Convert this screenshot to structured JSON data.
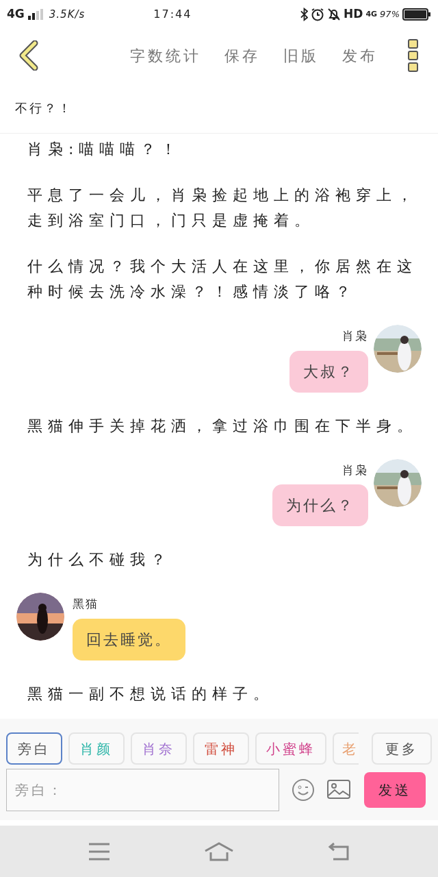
{
  "status_bar": {
    "network": "4G",
    "speed": "3.5K/s",
    "time": "17:44",
    "hd": "HD",
    "network_right": "4G",
    "battery": "97%"
  },
  "toolbar": {
    "actions": [
      "字数统计",
      "保存",
      "旧版",
      "发布"
    ]
  },
  "pinned_text": "不行？！",
  "feed": [
    {
      "kind": "text",
      "text": "肖枭:喵喵喵？！"
    },
    {
      "kind": "text",
      "text": "平息了一会儿，肖枭捡起地上的浴袍穿上，走到浴室门口，门只是虚掩着。"
    },
    {
      "kind": "text",
      "text": "什么情况？我个大活人在这里，你居然在这种时候去洗冷水澡？！感情淡了咯？"
    },
    {
      "kind": "outgoing",
      "name": "肖枭",
      "text": "大叔？"
    },
    {
      "kind": "text",
      "text": "黑猫伸手关掉花洒，拿过浴巾围在下半身。"
    },
    {
      "kind": "outgoing",
      "name": "肖枭",
      "text": "为什么？"
    },
    {
      "kind": "text",
      "text": "为什么不碰我？"
    },
    {
      "kind": "incoming",
      "name": "黑猫",
      "text": "回去睡觉。"
    },
    {
      "kind": "text",
      "text": "黑猫一副不想说话的样子。"
    }
  ],
  "roles": [
    {
      "label": "旁白",
      "selected": true,
      "color": "#555555"
    },
    {
      "label": "肖颜",
      "selected": false,
      "color": "#2bb5a8"
    },
    {
      "label": "肖奈",
      "selected": false,
      "color": "#a070d0"
    },
    {
      "label": "雷神",
      "selected": false,
      "color": "#d04a3a"
    },
    {
      "label": "小蜜蜂",
      "selected": false,
      "color": "#d0408a"
    },
    {
      "label": "老",
      "selected": false,
      "color": "#e8a070"
    }
  ],
  "more_button": "更多",
  "input": {
    "placeholder": "旁白："
  },
  "send_button": "发送"
}
